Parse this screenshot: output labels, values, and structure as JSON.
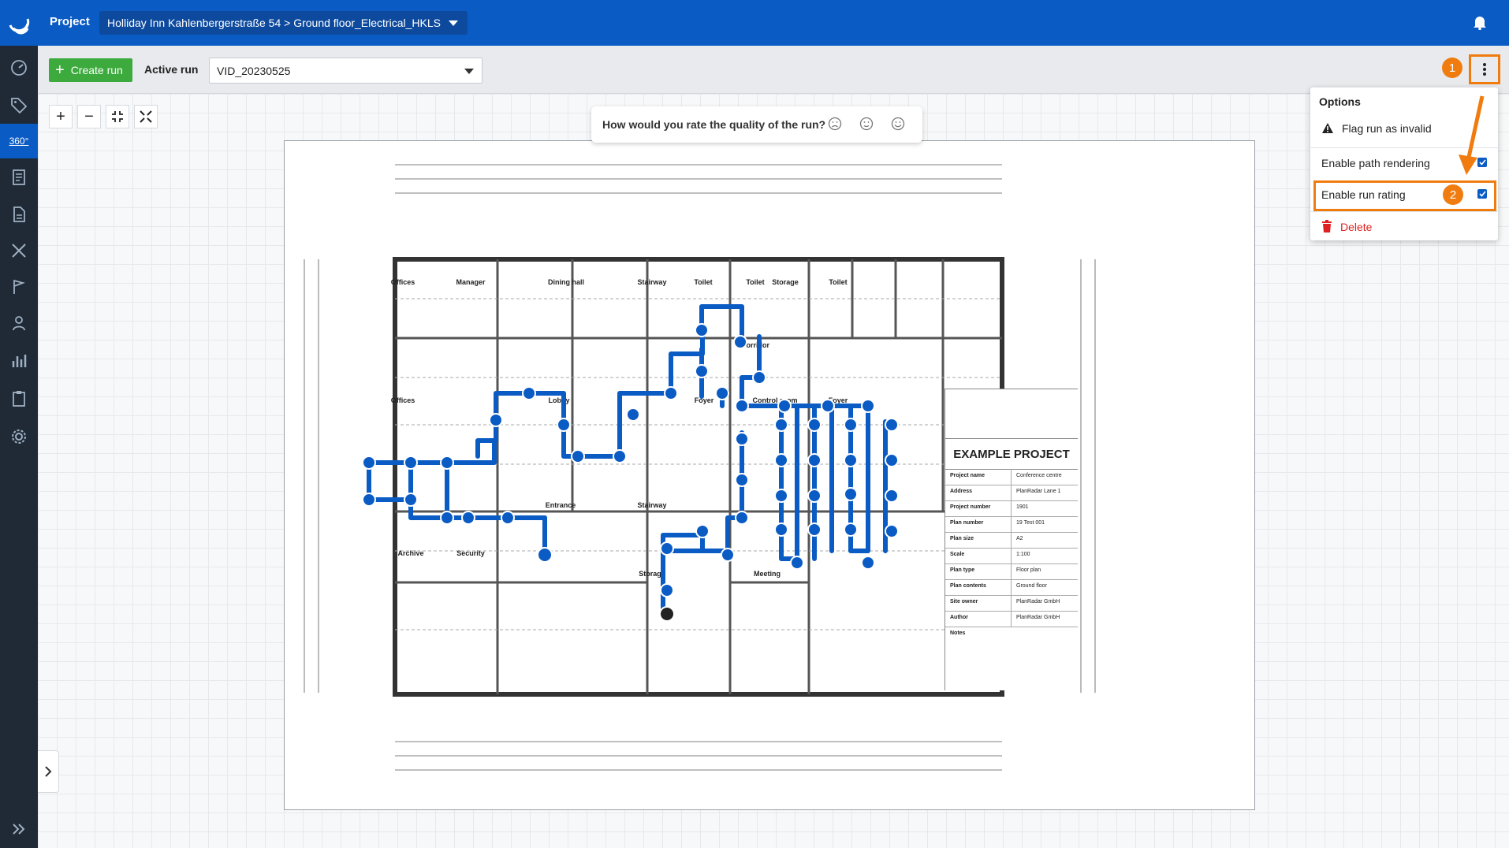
{
  "topbar": {
    "project_label": "Project",
    "project_path": "Holliday Inn Kahlenbergerstraße 54 > Ground floor_Electrical_HKLS"
  },
  "toolbar": {
    "create_run_label": "Create run",
    "active_run_label": "Active run",
    "active_run_value": "VID_20230525"
  },
  "sidebar": {
    "items": [
      {
        "name": "dashboard-icon"
      },
      {
        "name": "tag-icon"
      },
      {
        "name": "360-icon",
        "label": "360°"
      },
      {
        "name": "document-scan-icon"
      },
      {
        "name": "document-icon"
      },
      {
        "name": "tools-icon"
      },
      {
        "name": "map-flag-icon"
      },
      {
        "name": "user-icon"
      },
      {
        "name": "chart-icon"
      },
      {
        "name": "clipboard-icon"
      },
      {
        "name": "settings-icon"
      }
    ]
  },
  "rating": {
    "question": "How would you rate the quality of the run?"
  },
  "options_menu": {
    "title": "Options",
    "items": [
      {
        "label": "Flag run as invalid",
        "icon": "warning-icon"
      },
      {
        "label": "Enable path rendering",
        "checked": true
      },
      {
        "label": "Enable run rating",
        "checked": true
      },
      {
        "label": "Delete",
        "icon": "trash-icon",
        "color": "#e02020"
      }
    ]
  },
  "annotations": {
    "badge_1": "1",
    "badge_2": "2",
    "accent": "#f07c0f"
  },
  "plan": {
    "rooms": [
      "Offices",
      "Manager",
      "Dining hall",
      "Stairway",
      "Toilet",
      "Toilet",
      "Storage",
      "Toilet",
      "Corridor",
      "Offices",
      "Lobby",
      "Foyer",
      "Control room",
      "Foyer",
      "Archive",
      "Security",
      "Entrance",
      "Stairway",
      "Storage",
      "Meeting"
    ],
    "title_block": {
      "title": "EXAMPLE PROJECT",
      "rows": [
        {
          "k": "Project name",
          "v": "Conference centre"
        },
        {
          "k": "Address",
          "v": "PlanRadar Lane 1"
        },
        {
          "k": "Project number",
          "v": "1901"
        },
        {
          "k": "Plan number",
          "v": "19 Test 001"
        },
        {
          "k": "Plan size",
          "v": "A2"
        },
        {
          "k": "Scale",
          "v": "1:100"
        },
        {
          "k": "Plan type",
          "v": "Floor plan"
        },
        {
          "k": "Plan contents",
          "v": "Ground floor"
        },
        {
          "k": "Site owner",
          "v": "PlanRadar GmbH"
        },
        {
          "k": "Author",
          "v": "PlanRadar GmbH"
        },
        {
          "k": "Notes",
          "v": ""
        }
      ]
    }
  },
  "colors": {
    "brand_blue": "#0a5bc4",
    "sidebar": "#1f2a36",
    "green": "#3caa3c",
    "delete_red": "#e02020"
  }
}
